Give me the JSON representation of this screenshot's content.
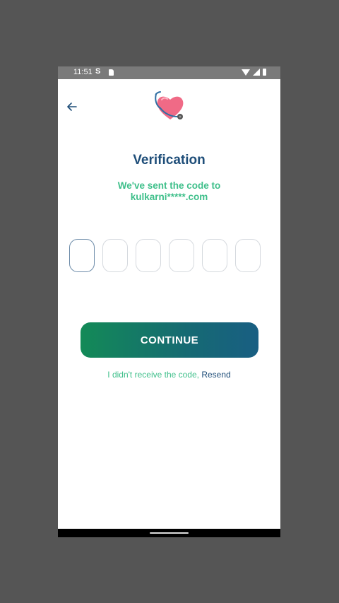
{
  "status_bar": {
    "time": "11:51",
    "s_icon": "S"
  },
  "header": {
    "back_icon": "arrow-left-icon",
    "logo_icon": "heart-stethoscope-logo"
  },
  "main": {
    "title": "Verification",
    "subtitle_line1": "We've sent the code to",
    "subtitle_line2": "kulkarni*****.com",
    "code_boxes": [
      "",
      "",
      "",
      "",
      "",
      ""
    ],
    "continue_label": "CONTINUE",
    "resend_prompt": "I didn't receive the code,",
    "resend_link": "Resend"
  },
  "colors": {
    "title": "#1f4e79",
    "accent_green": "#3ebf8a",
    "button_gradient_start": "#138a57",
    "button_gradient_end": "#185e82"
  }
}
